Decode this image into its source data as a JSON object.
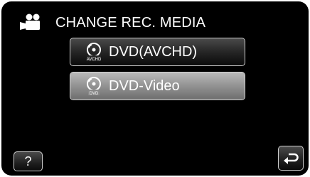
{
  "header": {
    "mode_icon": "video-camera-icon",
    "title": "CHANGE REC. MEDIA"
  },
  "options": [
    {
      "icon": "disc-avchd-icon",
      "icon_text": "AVCHD",
      "label": "DVD(AVCHD)",
      "style": "dark"
    },
    {
      "icon": "disc-dvd-video-icon",
      "icon_text": "DVD",
      "label": "DVD-Video",
      "style": "highlighted"
    }
  ],
  "footer": {
    "help_label": "?",
    "back_icon": "return-arrow-icon"
  },
  "colors": {
    "background": "#000000",
    "text": "#ffffff",
    "button_border": "#cfcfcf",
    "highlight": "#8e8e8e"
  }
}
